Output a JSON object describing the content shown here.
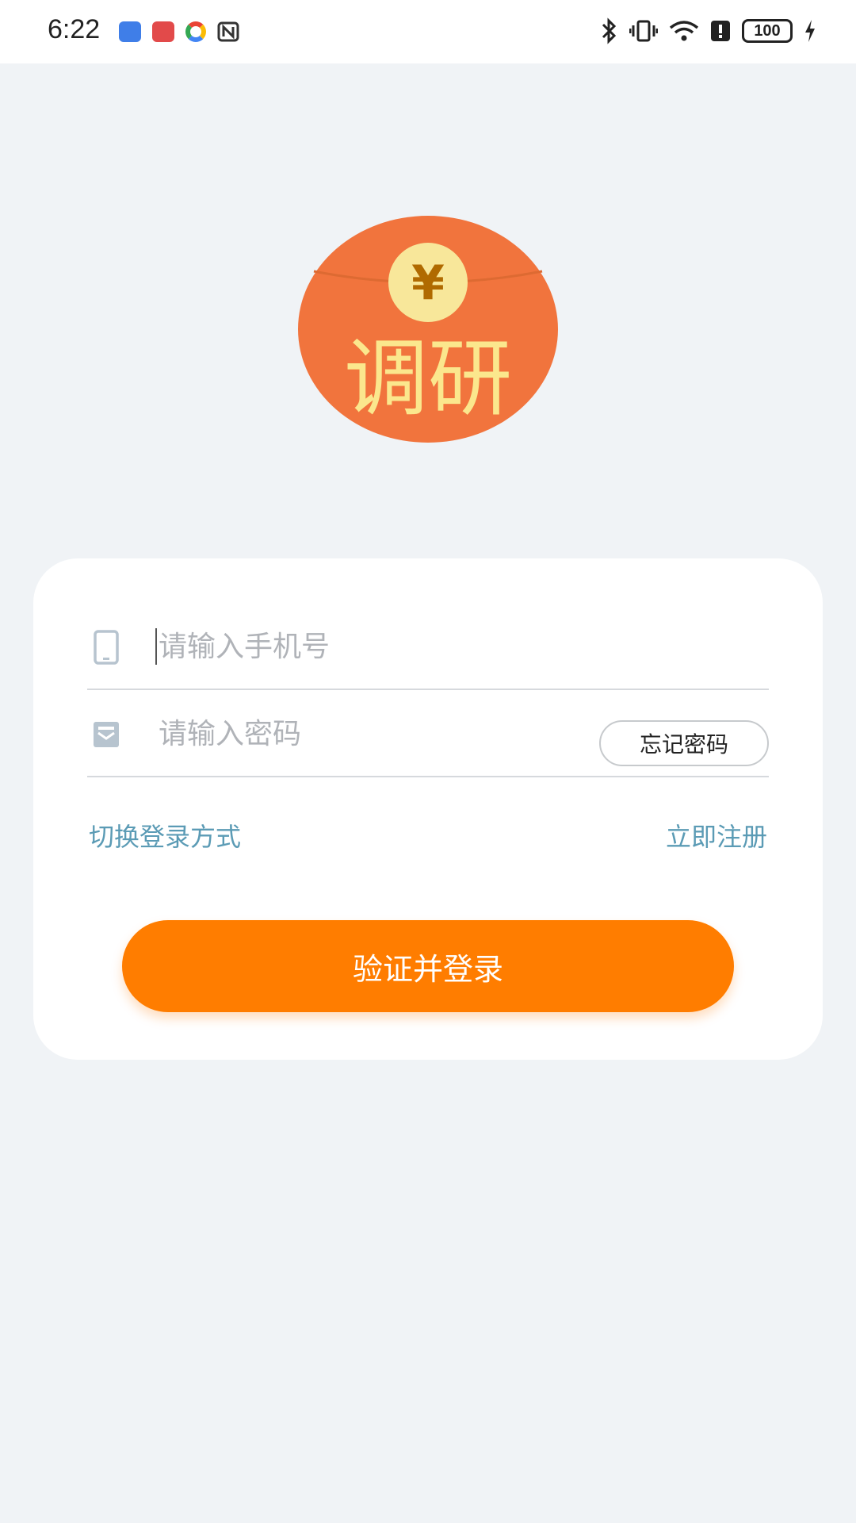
{
  "status_bar": {
    "time": "6:22",
    "battery": "100",
    "icons": [
      "blue-app-icon",
      "red-app-icon",
      "multicolor-app-icon",
      "nfc-icon",
      "bluetooth-icon",
      "vibrate-icon",
      "wifi-icon",
      "alert-icon",
      "battery-icon",
      "charging-icon"
    ]
  },
  "logo": {
    "currency_symbol": "¥",
    "text": "调研",
    "colors": {
      "circle": "#f1743d",
      "coin": "#f8e79a",
      "text": "#fbe78d"
    }
  },
  "form": {
    "phone_placeholder": "请输入手机号",
    "password_placeholder": "请输入密码",
    "forgot_password": "忘记密码",
    "switch_login": "切换登录方式",
    "register": "立即注册",
    "submit": "验证并登录"
  },
  "colors": {
    "accent": "#ff7d00",
    "link": "#5b9bb5",
    "background": "#f0f3f6"
  }
}
